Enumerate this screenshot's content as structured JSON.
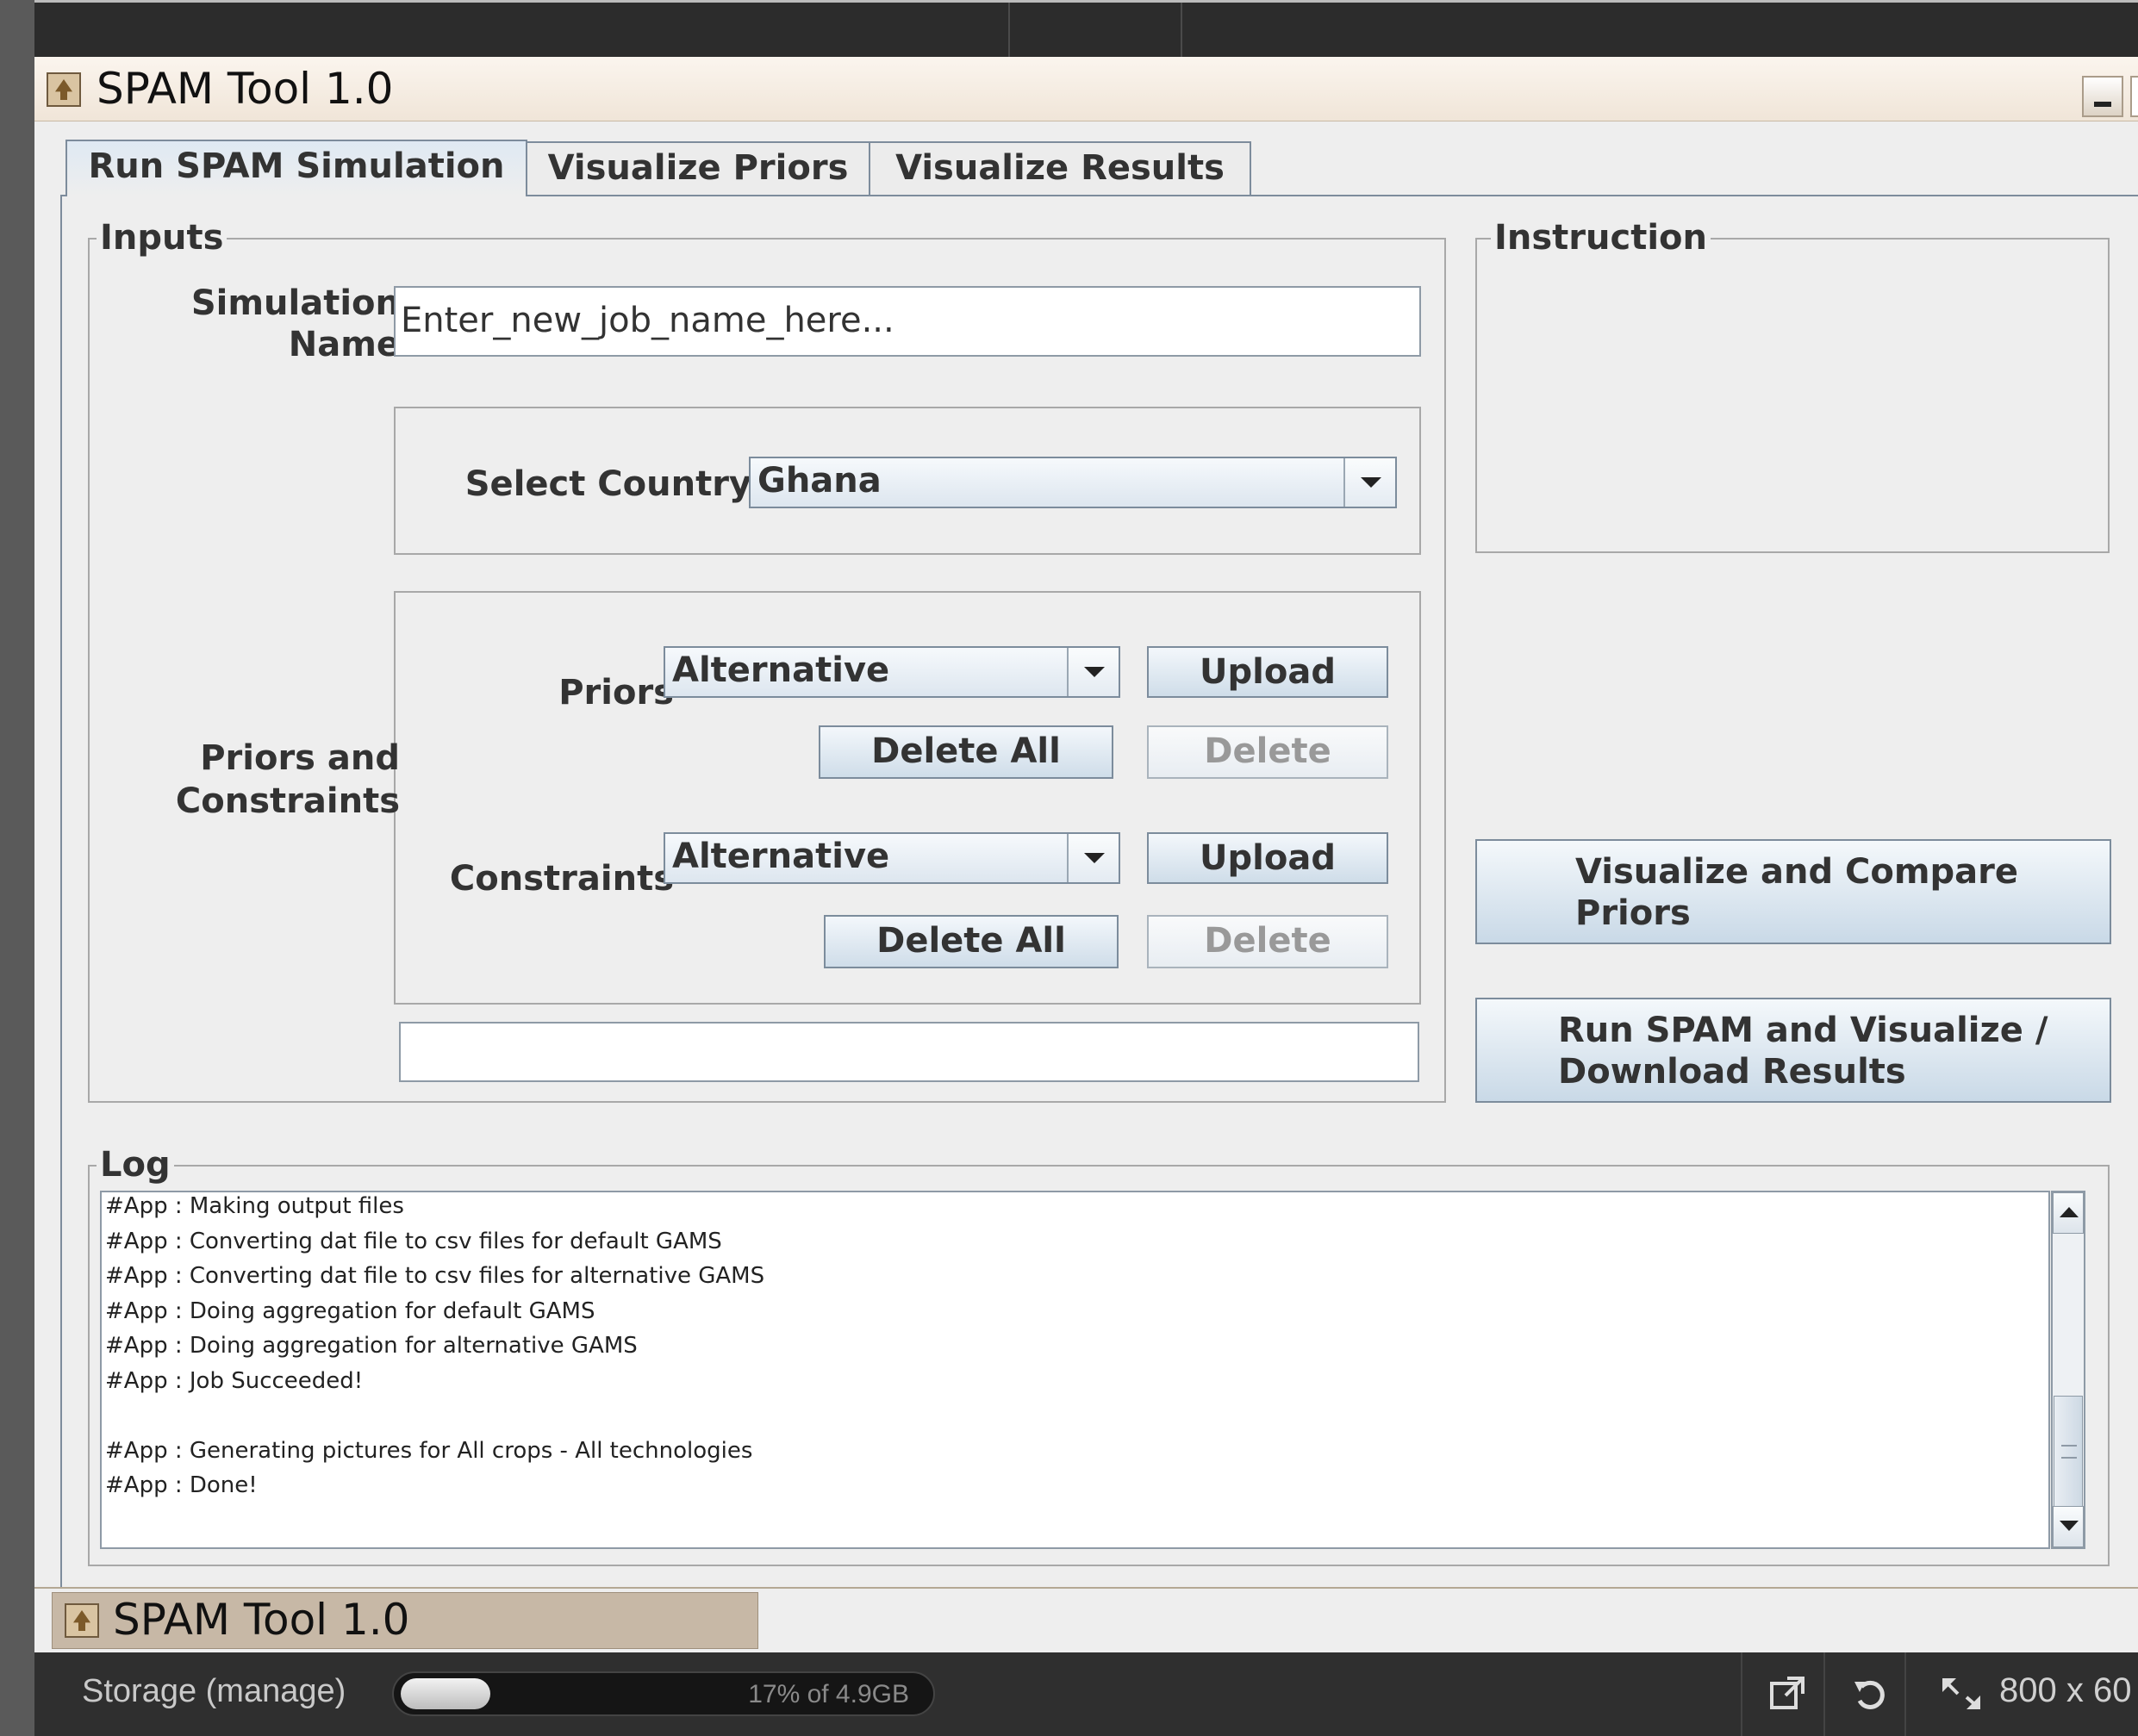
{
  "window": {
    "title": "SPAM Tool 1.0"
  },
  "tabs": [
    {
      "label": "Run SPAM Simulation"
    },
    {
      "label": "Visualize Priors"
    },
    {
      "label": "Visualize Results"
    }
  ],
  "inputs": {
    "group_title": "Inputs",
    "simulation_name_label_1": "Simulation",
    "simulation_name_label_2": "Name",
    "simulation_name_value": "Enter_new_job_name_here...",
    "select_country_label": "Select Country",
    "country_value": "Ghana",
    "priors_constraints_label_1": "Priors and",
    "priors_constraints_label_2": "Constraints",
    "priors_label": "Priors",
    "priors_value": "Alternative",
    "constraints_label": "Constraints",
    "constraints_value": "Alternative",
    "upload_label": "Upload",
    "delete_all_label": "Delete All",
    "delete_label": "Delete",
    "status_value": ""
  },
  "instruction": {
    "group_title": "Instruction",
    "text": ""
  },
  "actions": {
    "visualize_compare_line1": "Visualize and Compare",
    "visualize_compare_line2": "Priors",
    "run_spam_line1": "Run SPAM and Visualize /",
    "run_spam_line2": "Download Results"
  },
  "log": {
    "group_title": "Log",
    "lines": "#App : Making output files\n#App : Converting dat file to csv files for default GAMS\n#App : Converting dat file to csv files for alternative GAMS\n#App : Doing aggregation for default GAMS\n#App : Doing aggregation for alternative GAMS\n#App : Job Succeeded!\n\n#App : Generating pictures for All crops - All technologies\n#App : Done!"
  },
  "taskbar": {
    "item_title": "SPAM Tool 1.0"
  },
  "statusbar": {
    "storage_label": "Storage (manage)",
    "storage_used_fraction": 0.17,
    "storage_text": "17% of 4.9GB",
    "popout_icon": "external-window-icon",
    "rotate_icon": "rotate-icon",
    "resize_icon": "resize-icon",
    "size_text": "800 x 60"
  },
  "colors": {
    "accent": "#7d8c9c",
    "titlebar": "#f0e5d8",
    "statusbar": "#2f2f2f"
  }
}
